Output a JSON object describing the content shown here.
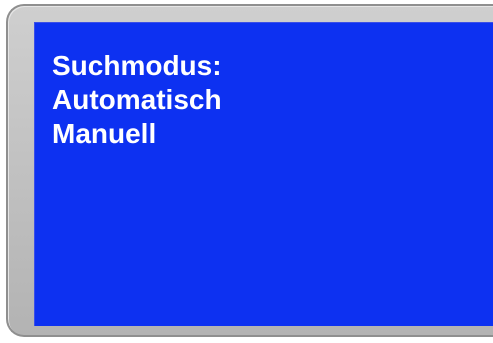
{
  "display": {
    "title": "Suchmodus:",
    "options": [
      {
        "label": "Automatisch"
      },
      {
        "label": "Manuell"
      }
    ],
    "colors": {
      "background": "#0d31f1",
      "text": "#ffffff",
      "bezel": "#c4c4c4"
    }
  }
}
